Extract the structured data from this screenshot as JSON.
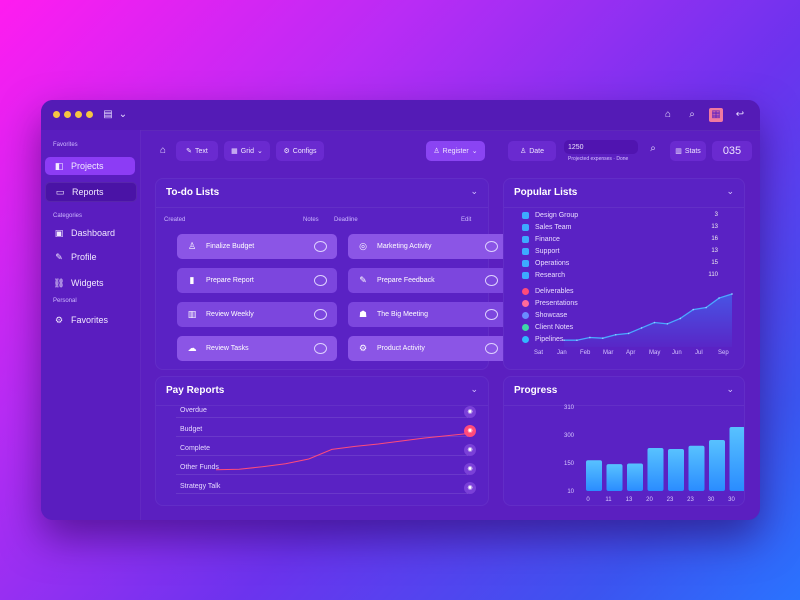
{
  "titlebar": {
    "icons": [
      "lock-icon",
      "search-icon",
      "calendar-icon",
      "refresh-icon"
    ]
  },
  "sidebar": {
    "heading1": "Favorites",
    "items1": [
      {
        "label": "Projects",
        "icon": "project-icon",
        "active": true
      },
      {
        "label": "Reports",
        "icon": "report-icon"
      }
    ],
    "heading2": "Categories",
    "items2": [
      {
        "label": "Dashboard",
        "icon": "dashboard-icon"
      },
      {
        "label": "Profile",
        "icon": "profile-icon"
      },
      {
        "label": "Widgets",
        "icon": "widget-icon"
      }
    ],
    "heading3": "Personal",
    "items3": [
      {
        "label": "Favorites",
        "icon": "star-icon"
      }
    ]
  },
  "toolbar": {
    "home": "Home",
    "btn1": "Text",
    "btn2": "Grid",
    "btn3": "Configs",
    "user": "Register",
    "datePill": "Date",
    "searchValue": "1250",
    "searchCaption": "Projected expenses · Done",
    "chartBtn": "Stats",
    "counter": "035"
  },
  "todo": {
    "title": "To-do Lists",
    "col1": "Created",
    "col1r": "Notes",
    "col2": "Deadline",
    "col2r": "Edit",
    "cards": [
      {
        "label": "Finalize Budget",
        "icon": "user-icon"
      },
      {
        "label": "Marketing Activity",
        "icon": "target-icon"
      },
      {
        "label": "Prepare Report",
        "icon": "chart-bar-icon"
      },
      {
        "label": "Prepare Feedback",
        "icon": "pen-icon"
      },
      {
        "label": "Review Weekly",
        "icon": "bar-chart-icon"
      },
      {
        "label": "The Big Meeting",
        "icon": "team-icon"
      },
      {
        "label": "Review Tasks",
        "icon": "cloud-icon"
      },
      {
        "label": "Product Activity",
        "icon": "gear-icon"
      }
    ]
  },
  "popular": {
    "title": "Popular Lists",
    "rows": [
      {
        "label": "Design Group",
        "value": "3"
      },
      {
        "label": "Sales Team",
        "value": "13"
      },
      {
        "label": "Finance",
        "value": "16"
      },
      {
        "label": "Support",
        "value": "13"
      },
      {
        "label": "Operations",
        "value": "15"
      },
      {
        "label": "Research",
        "value": "110"
      }
    ],
    "rows2": [
      {
        "label": "Deliverables",
        "color": "#ff4b7a"
      },
      {
        "label": "Presentations",
        "color": "#ff6a9a"
      },
      {
        "label": "Showcase",
        "color": "#6a8cff"
      },
      {
        "label": "Client Notes",
        "color": "#3ed6a8"
      },
      {
        "label": "Pipelines",
        "color": "#31b7ff"
      }
    ],
    "xTicks": [
      "Sat",
      "Jan",
      "Feb",
      "Mar",
      "Apr",
      "May",
      "Jun",
      "Jul",
      "Sep"
    ]
  },
  "chart_data": [
    {
      "type": "area",
      "title": "",
      "x": [
        1,
        2,
        3,
        4,
        5,
        6,
        7,
        8,
        9,
        10,
        11,
        12,
        13,
        14
      ],
      "values": [
        10,
        10,
        14,
        13,
        18,
        20,
        28,
        36,
        34,
        42,
        55,
        58,
        72,
        78
      ],
      "ylim": [
        0,
        100
      ]
    },
    {
      "type": "line",
      "title": "Pay Reports",
      "values": [
        12,
        13,
        17,
        22,
        30,
        46,
        51,
        55,
        60,
        65,
        69,
        73
      ],
      "ylim": [
        0,
        100
      ]
    },
    {
      "type": "bar",
      "title": "Progress",
      "categories": [
        "0",
        "11",
        "13",
        "20",
        "23",
        "23",
        "30",
        "30",
        "30"
      ],
      "values": [
        95,
        83,
        85,
        133,
        130,
        140,
        158,
        198
      ],
      "yticks": [
        "10",
        "150",
        "300",
        "310"
      ],
      "ylim": [
        0,
        260
      ]
    }
  ],
  "payreports": {
    "title": "Pay Reports",
    "rows": [
      "Overdue",
      "Budget",
      "Complete",
      "Other Funds",
      "Strategy Talk"
    ]
  },
  "progress": {
    "title": "Progress"
  },
  "colors": {
    "accent": "#8b3cf5",
    "card": "#8b55e6",
    "bar": "#3aa9ff",
    "line": "#ff4b7a"
  }
}
